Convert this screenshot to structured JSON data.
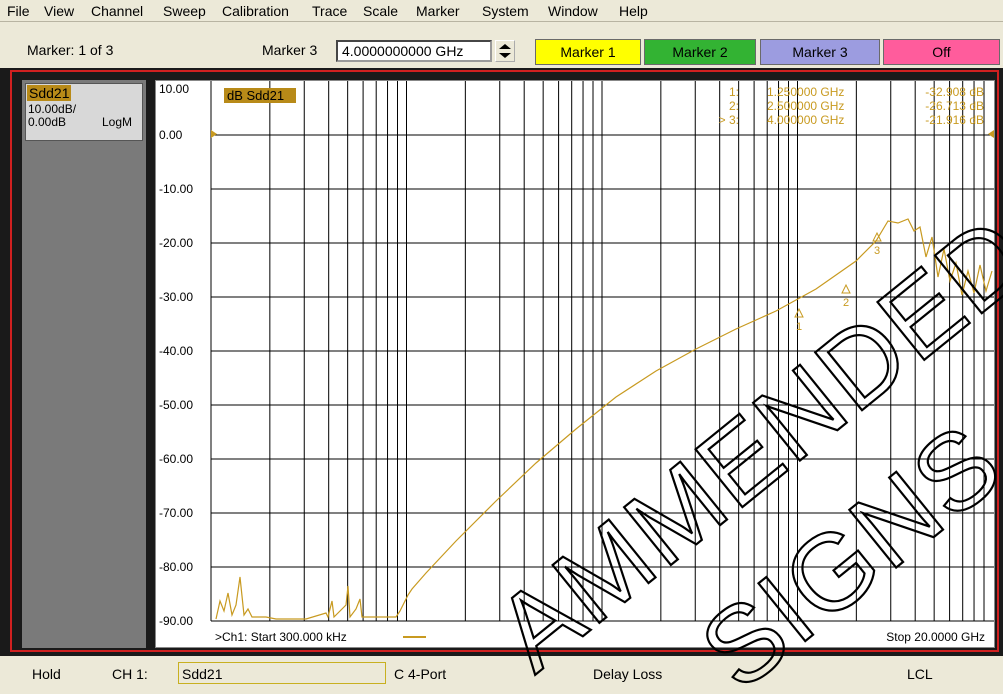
{
  "menu": [
    "File",
    "View",
    "Channel",
    "Sweep",
    "Calibration",
    "Trace",
    "Scale",
    "Marker",
    "System",
    "Window",
    "Help"
  ],
  "toolbar": {
    "marker_count": "Marker: 1 of 3",
    "marker_select_label": "Marker 3",
    "frequency_value": "4.0000000000 GHz",
    "buttons": [
      {
        "label": "Marker 1",
        "color": "#ffff00"
      },
      {
        "label": "Marker 2",
        "color": "#33b333"
      },
      {
        "label": "Marker 3",
        "color": "#9c9ce0"
      },
      {
        "label": "Off",
        "color": "#ff5c9c"
      }
    ]
  },
  "trace_panel": {
    "name": "Sdd21",
    "scale": "10.00dB/",
    "ref": "0.00dB",
    "format": "LogM"
  },
  "plot": {
    "trace_label": "dB Sdd21",
    "yticks": [
      "10.00",
      "0.00",
      "-10.00",
      "-20.00",
      "-30.00",
      "-40.00",
      "-50.00",
      "-60.00",
      "-70.00",
      "-80.00",
      "-90.00"
    ],
    "start_label": ">Ch1: Start  300.000 kHz",
    "stop_label": "Stop  20.0000 GHz",
    "markers": [
      {
        "num": "1:",
        "freq": "1.250000 GHz",
        "val": "-32.908 dB"
      },
      {
        "num": "2:",
        "freq": "2.500000 GHz",
        "val": "-26.713 dB"
      },
      {
        "num": "> 3:",
        "freq": "4.000000 GHz",
        "val": "-21.916 dB"
      }
    ],
    "marker_symbols": [
      "1",
      "2",
      "3"
    ],
    "colors": {
      "trace": "#c89a20",
      "grid": "#000000"
    }
  },
  "status": {
    "mode": "Hold",
    "channel": "CH 1:",
    "measurement": "Sdd21",
    "port": "C  4-Port",
    "delay": "Delay Loss",
    "lcl": "LCL"
  },
  "watermark": [
    "AMMENDED",
    "SIGNS"
  ]
}
